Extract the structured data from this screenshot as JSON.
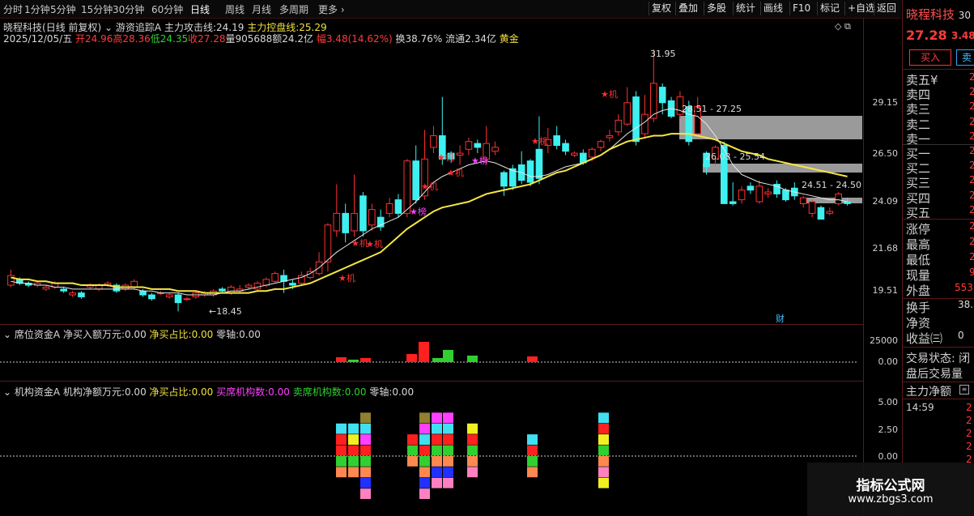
{
  "toolbar": {
    "left_items": [
      "分时",
      "1分钟",
      "5分钟",
      "15分钟",
      "30分钟",
      "60分钟",
      "日线",
      "周线",
      "月线",
      "多周期",
      "更多"
    ],
    "right_buttons": [
      "复权",
      "叠加",
      "多股",
      "统计",
      "画线",
      "F10",
      "标记",
      "+自选",
      "返回"
    ]
  },
  "header": {
    "stock_name": "晓程科技",
    "period_label": "(日线 前复权)",
    "indicator": "游资追踪A",
    "attack_label": "主力攻击线:",
    "attack_value": "24.19",
    "control_label": "主力控盘线:",
    "control_value": "25.29"
  },
  "quote_line": {
    "date": "2025/12/05/五",
    "open": "开24.96",
    "high": "高28.36",
    "low": "低24.35",
    "close": "收27.28",
    "volume": "量905688",
    "amount": "额24.2亿",
    "change": "幅3.48(14.62%)",
    "turnover": "换38.76%",
    "float": "流通2.34亿",
    "tag": "黄金"
  },
  "panel2": {
    "name": "席位资金A",
    "net_label": "净买入额万元:",
    "net_value": "0.00",
    "ratio_label": "净买占比:",
    "ratio_value": "0.00",
    "zero_label": "零轴:",
    "zero_value": "0.00",
    "axis": [
      "25000",
      "0.00"
    ]
  },
  "panel3": {
    "name": "机构资金A",
    "net_label": "机构净额万元:",
    "net_value": "0.00",
    "ratio_label": "净买占比:",
    "ratio_value": "0.00",
    "buy_label": "买席机构数:",
    "buy_value": "0.00",
    "sell_label": "卖席机构数:",
    "sell_value": "0.00",
    "zero_label": "零轴:",
    "zero_value": "0.00",
    "axis": [
      "5.00",
      "2.50",
      "0.00"
    ]
  },
  "main_axis": [
    "29.15",
    "26.50",
    "24.09",
    "21.68",
    "19.51"
  ],
  "annotations": {
    "high": "31.95",
    "low": "←18.45",
    "zone1": "28.51 - 27.25",
    "zone2": "26.03 - 25.54",
    "zone3": "24.51 - 24.50",
    "cai": "财",
    "ji": "★机",
    "bang": "★榜"
  },
  "right_panel": {
    "title": "晓程科技",
    "code": "30",
    "price": "27.28",
    "change": "3.48",
    "buy_btn": "买入",
    "sell_btn": "卖",
    "ask_labels": [
      "卖五",
      "卖四",
      "卖三",
      "卖二",
      "卖一"
    ],
    "bid_labels": [
      "买一",
      "买二",
      "买三",
      "买四",
      "买五"
    ],
    "ask_mark": "¥",
    "book_vals": [
      "2",
      "2",
      "2",
      "2",
      "2",
      "2",
      "2",
      "2",
      "2",
      "2"
    ],
    "stats": [
      {
        "label": "涨停",
        "value": "2"
      },
      {
        "label": "最高",
        "value": "2"
      },
      {
        "label": "最低",
        "value": "2"
      },
      {
        "label": "现量",
        "value": "9"
      },
      {
        "label": "外盘",
        "value": "553"
      }
    ],
    "stats2": [
      {
        "label": "换手",
        "value": "38."
      },
      {
        "label": "净资",
        "value": ""
      },
      {
        "label": "收益㈢",
        "value": "0"
      }
    ],
    "trade_status": "交易状态: 闭",
    "after_hours": "盘后交易量",
    "main_net": "主力净额",
    "tick_time": "14:59",
    "tick_vals": [
      "2",
      "2",
      "2",
      "2",
      "2"
    ]
  },
  "watermark": {
    "line1": "指标公式网",
    "line2": "www.zbgs3.com"
  },
  "chart_data": {
    "type": "candlestick",
    "ylim": [
      18.0,
      33.0
    ],
    "y_ticks": [
      29.15,
      26.5,
      24.09,
      21.68,
      19.51
    ],
    "candles": [
      [
        19.8,
        20.3,
        19.7,
        20.6
      ],
      [
        20.1,
        19.9,
        19.8,
        20.2
      ],
      [
        19.9,
        19.8,
        19.7,
        20.0
      ],
      [
        19.8,
        19.9,
        19.7,
        20.0
      ],
      [
        19.6,
        19.7,
        19.5,
        19.8
      ],
      [
        19.7,
        19.9,
        19.6,
        20.0
      ],
      [
        19.6,
        19.5,
        19.4,
        19.7
      ],
      [
        19.3,
        19.4,
        19.2,
        19.5
      ],
      [
        19.4,
        19.2,
        19.1,
        19.5
      ],
      [
        19.7,
        19.8,
        19.6,
        19.9
      ],
      [
        19.6,
        19.8,
        19.5,
        19.9
      ],
      [
        19.8,
        19.9,
        19.7,
        20.0
      ],
      [
        19.8,
        19.5,
        19.4,
        19.9
      ],
      [
        19.6,
        19.8,
        19.5,
        19.9
      ],
      [
        19.7,
        20.0,
        19.6,
        20.1
      ],
      [
        19.5,
        19.3,
        19.2,
        19.6
      ],
      [
        19.3,
        19.1,
        19.0,
        19.4
      ],
      [
        19.4,
        19.4,
        19.3,
        19.5
      ],
      [
        19.2,
        19.3,
        19.1,
        19.4
      ],
      [
        19.3,
        18.9,
        18.45,
        19.4
      ],
      [
        19.1,
        19.1,
        19.0,
        19.2
      ],
      [
        19.2,
        19.4,
        19.1,
        19.5
      ],
      [
        19.3,
        19.4,
        19.2,
        19.5
      ],
      [
        19.3,
        19.5,
        19.2,
        19.6
      ],
      [
        19.6,
        19.5,
        19.4,
        19.7
      ],
      [
        19.4,
        19.7,
        19.3,
        19.8
      ],
      [
        19.5,
        19.6,
        19.4,
        19.8
      ],
      [
        19.7,
        19.8,
        19.6,
        19.9
      ],
      [
        19.6,
        19.9,
        19.5,
        20.0
      ],
      [
        19.8,
        20.1,
        19.7,
        20.2
      ],
      [
        20.0,
        20.4,
        19.9,
        20.5
      ],
      [
        20.3,
        20.0,
        19.4,
        20.6
      ],
      [
        19.9,
        19.8,
        19.6,
        20.1
      ],
      [
        19.9,
        20.3,
        19.8,
        20.5
      ],
      [
        20.2,
        20.5,
        20.1,
        20.7
      ],
      [
        20.4,
        21.0,
        20.3,
        21.5
      ],
      [
        21.0,
        22.9,
        20.5,
        23.0
      ],
      [
        22.6,
        23.5,
        22.3,
        25.0
      ],
      [
        23.5,
        22.5,
        22.0,
        24.0
      ],
      [
        22.6,
        23.5,
        22.3,
        25.5
      ],
      [
        24.4,
        22.6,
        22.3,
        24.6
      ],
      [
        22.9,
        23.7,
        22.6,
        24.0
      ],
      [
        23.3,
        22.8,
        22.6,
        23.7
      ],
      [
        23.5,
        24.0,
        23.3,
        24.3
      ],
      [
        24.2,
        23.5,
        23.3,
        24.5
      ],
      [
        23.5,
        26.2,
        23.3,
        26.3
      ],
      [
        26.2,
        24.2,
        24.0,
        27.0
      ],
      [
        24.4,
        26.3,
        24.2,
        27.8
      ],
      [
        26.9,
        27.5,
        26.6,
        28.0
      ],
      [
        27.5,
        26.3,
        26.0,
        29.5
      ],
      [
        26.6,
        26.3,
        26.1,
        26.7
      ],
      [
        26.5,
        26.6,
        26.0,
        27.0
      ],
      [
        26.8,
        27.2,
        26.5,
        27.4
      ],
      [
        27.1,
        26.9,
        26.6,
        27.3
      ],
      [
        26.3,
        27.1,
        26.0,
        28.0
      ],
      [
        26.7,
        26.9,
        26.5,
        27.2
      ],
      [
        25.6,
        24.9,
        24.4,
        25.7
      ],
      [
        25.8,
        24.9,
        24.7,
        26.0
      ],
      [
        26.0,
        25.2,
        25.0,
        26.7
      ],
      [
        26.2,
        25.1,
        24.9,
        26.3
      ],
      [
        26.8,
        25.3,
        25.0,
        28.5
      ],
      [
        27.0,
        27.3,
        26.6,
        27.9
      ],
      [
        27.5,
        27.0,
        26.8,
        28.0
      ],
      [
        27.1,
        26.7,
        26.5,
        27.3
      ],
      [
        26.5,
        26.6,
        26.4,
        26.7
      ],
      [
        26.6,
        26.1,
        26.0,
        26.8
      ],
      [
        26.4,
        26.8,
        26.2,
        26.9
      ],
      [
        26.9,
        27.2,
        26.7,
        27.3
      ],
      [
        27.4,
        27.5,
        27.2,
        27.8
      ],
      [
        27.7,
        28.3,
        27.5,
        28.6
      ],
      [
        28.1,
        29.2,
        28.0,
        30.0
      ],
      [
        29.5,
        27.2,
        27.0,
        29.8
      ],
      [
        27.6,
        28.6,
        27.4,
        29.6
      ],
      [
        28.4,
        30.2,
        28.2,
        31.95
      ],
      [
        30.0,
        29.2,
        28.6,
        30.2
      ],
      [
        29.3,
        28.5,
        28.4,
        29.5
      ],
      [
        28.6,
        29.5,
        28.4,
        29.8
      ],
      [
        29.0,
        27.2,
        27.0,
        29.3
      ],
      [
        27.6,
        29.0,
        27.5,
        29.5
      ],
      [
        26.6,
        25.9,
        25.5,
        26.7
      ],
      [
        26.3,
        26.9,
        26.0,
        27.0
      ],
      [
        27.0,
        24.0,
        24.4,
        27.2
      ],
      [
        24.1,
        24.0,
        23.9,
        25.1
      ],
      [
        24.2,
        24.7,
        24.0,
        24.9
      ],
      [
        24.9,
        24.7,
        24.5,
        25.1
      ],
      [
        24.1,
        24.9,
        24.0,
        25.2
      ],
      [
        24.5,
        24.6,
        24.3,
        24.8
      ],
      [
        25.0,
        24.5,
        24.3,
        25.2
      ],
      [
        24.7,
        24.2,
        24.1,
        24.8
      ],
      [
        24.8,
        24.4,
        24.2,
        25.1
      ],
      [
        24.0,
        24.3,
        23.8,
        24.4
      ],
      [
        23.5,
        24.1,
        23.3,
        24.2
      ],
      [
        23.8,
        23.2,
        23.2,
        23.9
      ],
      [
        23.5,
        23.6,
        23.4,
        23.8
      ],
      [
        24.0,
        24.5,
        23.9,
        24.6
      ],
      [
        24.1,
        24.0,
        23.9,
        24.3
      ]
    ],
    "ma_white": [
      20.0,
      19.9,
      19.9,
      19.8,
      19.8,
      19.7,
      19.7,
      19.6,
      19.6,
      19.6,
      19.6,
      19.6,
      19.6,
      19.6,
      19.6,
      19.5,
      19.5,
      19.4,
      19.4,
      19.4,
      19.3,
      19.3,
      19.3,
      19.3,
      19.4,
      19.5,
      19.5,
      19.6,
      19.7,
      19.8,
      19.9,
      20.0,
      20.1,
      20.2,
      20.4,
      20.7,
      21.1,
      21.5,
      21.8,
      22.1,
      22.4,
      22.7,
      22.9,
      23.1,
      23.3,
      23.7,
      24.1,
      24.6,
      25.1,
      25.4,
      25.6,
      25.8,
      26.0,
      26.1,
      26.2,
      26.1,
      25.9,
      25.7,
      25.6,
      25.4,
      25.4,
      25.5,
      25.7,
      25.9,
      26.0,
      26.1,
      26.3,
      26.5,
      26.8,
      27.2,
      27.6,
      27.9,
      28.2,
      28.6,
      28.8,
      28.9,
      28.8,
      28.6,
      28.5,
      28.1,
      27.5,
      26.8,
      26.0,
      25.5,
      25.3,
      25.1,
      25.0,
      24.9,
      24.7,
      24.6,
      24.5,
      24.4,
      24.3,
      24.2,
      24.2,
      24.1
    ],
    "ma_yellow": [
      20.2,
      20.1,
      20.1,
      20.0,
      20.0,
      19.9,
      19.9,
      19.9,
      19.8,
      19.8,
      19.8,
      19.8,
      19.7,
      19.7,
      19.7,
      19.7,
      19.6,
      19.6,
      19.6,
      19.5,
      19.5,
      19.5,
      19.4,
      19.4,
      19.4,
      19.4,
      19.4,
      19.4,
      19.5,
      19.5,
      19.6,
      19.6,
      19.7,
      19.8,
      19.9,
      20.1,
      20.3,
      20.5,
      20.7,
      20.9,
      21.1,
      21.3,
      21.5,
      21.9,
      22.3,
      22.7,
      23.0,
      23.3,
      23.6,
      23.8,
      23.9,
      24.0,
      24.1,
      24.3,
      24.5,
      24.6,
      24.7,
      24.8,
      24.9,
      25.0,
      25.2,
      25.4,
      25.6,
      25.7,
      25.9,
      26.1,
      26.3,
      26.5,
      26.8,
      27.0,
      27.2,
      27.3,
      27.4,
      27.5,
      27.5,
      27.6,
      27.6,
      27.6,
      27.5,
      27.4,
      27.3,
      27.1,
      26.9,
      26.7,
      26.6,
      26.5,
      26.3,
      26.2,
      26.1,
      26.0,
      25.9,
      25.8,
      25.7,
      25.6,
      25.5,
      25.4
    ]
  }
}
